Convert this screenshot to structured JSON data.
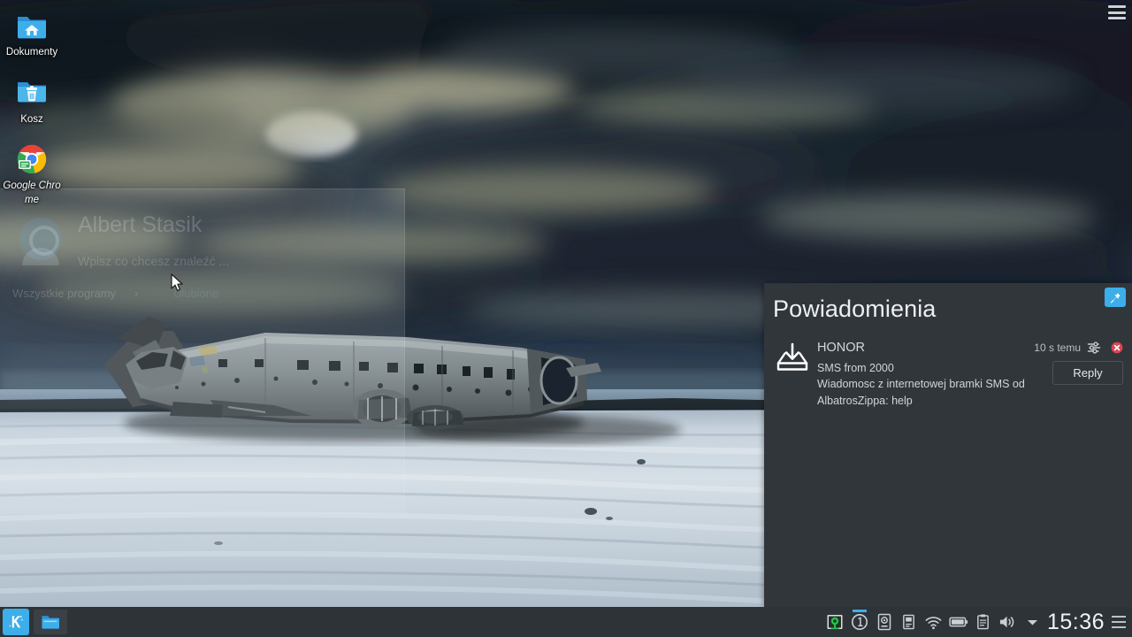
{
  "desktop": {
    "icons": [
      {
        "name": "home-folder",
        "label": "Dokumenty",
        "icon": "folder-home-icon",
        "italic": false
      },
      {
        "name": "trash",
        "label": "Kosz",
        "icon": "folder-trash-icon",
        "italic": false
      },
      {
        "name": "google-chrome",
        "label": "Google Chrome",
        "icon": "chrome-icon",
        "italic": true
      }
    ],
    "toolbox_icon": "hamburger-menu-icon"
  },
  "launcher_ghost": {
    "user_name": "Albert Stasik",
    "search_placeholder": "Wpisz co chcesz znaleźć ...",
    "all_programs": "Wszystkie programy",
    "arrow": "›",
    "favorites": "Ulubione",
    "avatar_icon": "user-avatar-icon"
  },
  "notifications": {
    "title": "Powiadomienia",
    "pin_icon": "pin-icon",
    "items": [
      {
        "app": "HONOR",
        "icon": "download-tray-icon",
        "time": "10 s temu",
        "config_icon": "settings-sliders-icon",
        "close_icon": "close-circle-icon",
        "lines": [
          "SMS from 2000",
          "Wiadomosc z internetowej bramki SMS od",
          "AlbatrosZippa: help"
        ],
        "action_label": "Reply"
      }
    ]
  },
  "panel": {
    "launcher": {
      "name": "kde-application-launcher",
      "icon": "kde-k-icon"
    },
    "tasks": [
      {
        "name": "file-manager-task",
        "icon": "folder-icon"
      }
    ],
    "systray": [
      {
        "name": "tray-clipboard-manager",
        "icon": "klipper-icon",
        "badge": false
      },
      {
        "name": "tray-updates",
        "icon": "update-circle-icon",
        "badge": true
      },
      {
        "name": "tray-device-notifier",
        "icon": "device-notifier-icon",
        "badge": false
      },
      {
        "name": "tray-removable-media",
        "icon": "usb-drive-icon",
        "badge": false
      },
      {
        "name": "tray-network",
        "icon": "wifi-icon",
        "badge": false
      },
      {
        "name": "tray-battery",
        "icon": "battery-icon",
        "badge": false
      },
      {
        "name": "tray-clipboard",
        "icon": "clipboard-icon",
        "badge": false
      },
      {
        "name": "tray-volume",
        "icon": "speaker-icon",
        "badge": false
      }
    ],
    "expand_icon": "chevron-down-icon",
    "clock": "15:36",
    "toolbox_icon": "panel-hamburger-icon"
  },
  "colors": {
    "accent": "#3daee9",
    "panel_bg": "#2e3338",
    "notif_bg": "#31363b",
    "close_red": "#da4453",
    "text": "#eceff1"
  }
}
